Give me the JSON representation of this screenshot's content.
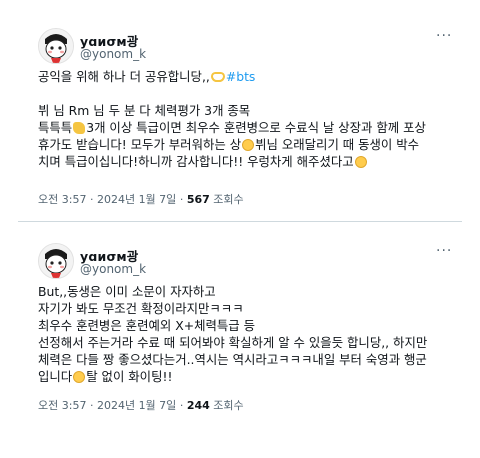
{
  "tweets": [
    {
      "name": "yɑиσм광",
      "handle": "@yonom_k",
      "lines": [
        {
          "pre": "공익을 위해 하나 더 공유합니당,,",
          "emoji": "yellow-heart-hands",
          "tag": "#bts"
        },
        {
          "blank": true
        },
        {
          "pre": "뷔 님 Rm 님 두 분 다 체력평가 3개 종목"
        },
        {
          "pre": "특특특",
          "emoji": "thumbs-up",
          "post": "3개 이상 특급이면 최우수 훈련병으로 수료식 날 상장과 함께 포상"
        },
        {
          "pre": "휴가도 받습니다! 모두가 부러워하는 상",
          "emoji": "smiling-face",
          "post": "뷔님 오래달리기 때 동생이 박수"
        },
        {
          "pre": "치며 특급이십니다!하니까 감사합니다!! 우렁차게 해주셨다고",
          "emoji": "laughing-face"
        }
      ],
      "time": "오전 3:57",
      "date": "2024년 1월 7일",
      "views": "567",
      "views_label": "조회수"
    },
    {
      "name": "yɑиσм광",
      "handle": "@yonom_k",
      "lines": [
        {
          "pre": "But,,동생은 이미 소문이 자자하고"
        },
        {
          "pre": "자기가 봐도 무조건 확정이라지만ㅋㅋㅋ"
        },
        {
          "pre": "최우수 훈련병은 훈련예외 X+체력특급 등"
        },
        {
          "pre": "선정해서 주는거라 수료 때 되어봐야 확실하게 알 수 있을듯 합니당,, 하지만"
        },
        {
          "pre": "체력은 다들 짱 좋으셨다는거..역시는 역시라고ㅋㅋㅋ내일 부터 숙영과 행군"
        },
        {
          "pre": "입니다",
          "emoji": "smiling-face",
          "post": "탈 없이 화이팅!!"
        }
      ],
      "time": "오전 3:57",
      "date": "2024년 1월 7일",
      "views": "244",
      "views_label": "조회수"
    }
  ]
}
